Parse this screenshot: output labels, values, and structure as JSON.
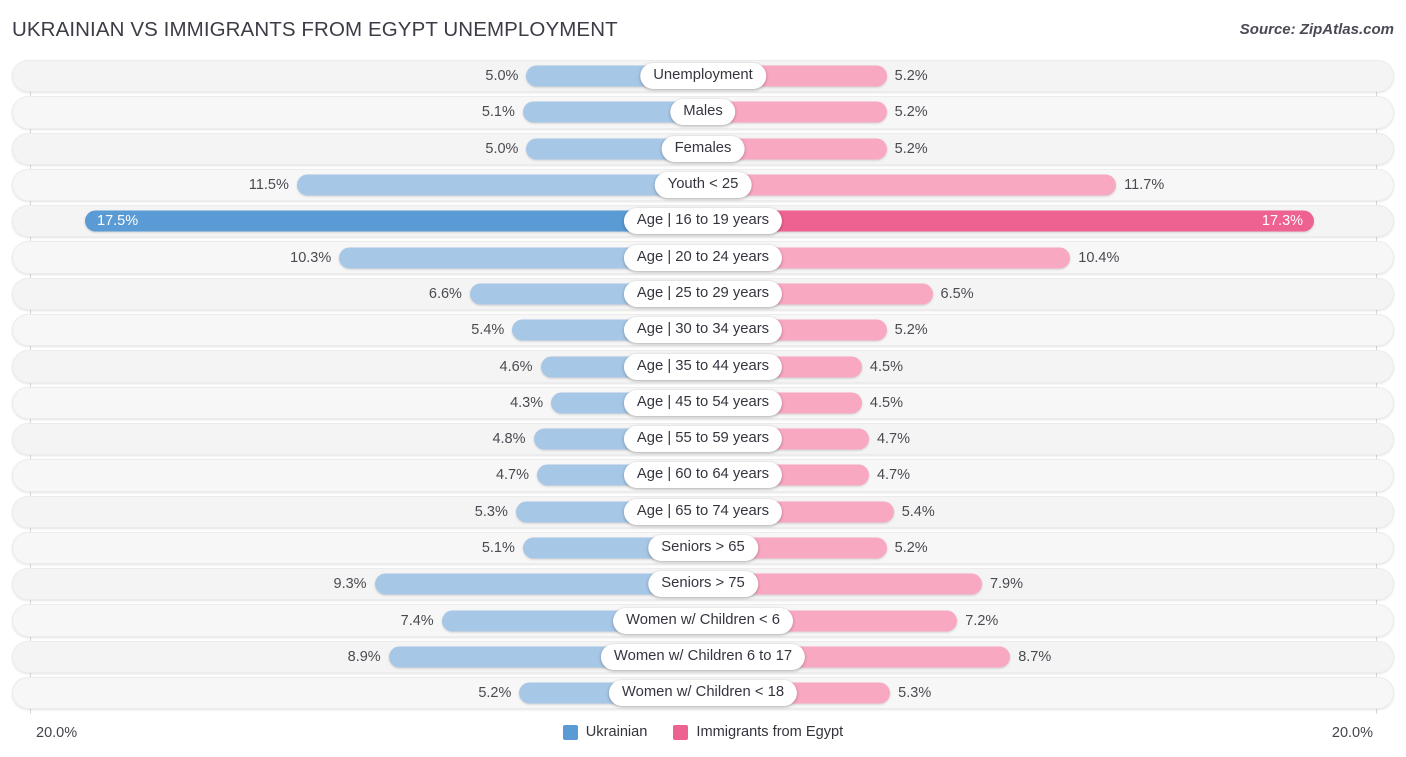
{
  "header": {
    "title": "UKRAINIAN VS IMMIGRANTS FROM EGYPT UNEMPLOYMENT",
    "source": "Source: ZipAtlas.com"
  },
  "axis": {
    "left_label": "20.0%",
    "right_label": "20.0%",
    "max": 20.0
  },
  "legend": {
    "items": [
      {
        "label": "Ukrainian",
        "color": "#5b9bd5"
      },
      {
        "label": "Immigrants from Egypt",
        "color": "#ee6292"
      }
    ]
  },
  "colors": {
    "left_normal": "#a7c7e7",
    "right_normal": "#f9a8c2",
    "left_highlight": "#5b9bd5",
    "right_highlight": "#ee6292",
    "track": "#f4f4f4",
    "track_alt": "#f7f7f7"
  },
  "chart_data": {
    "type": "bar",
    "subtype": "diverging-bidirectional",
    "title": "UKRAINIAN VS IMMIGRANTS FROM EGYPT UNEMPLOYMENT",
    "xlabel": "",
    "ylabel": "",
    "xlim": [
      20.0,
      20.0
    ],
    "grid": false,
    "legend_position": "bottom-center",
    "unit": "%",
    "categories": [
      "Unemployment",
      "Males",
      "Females",
      "Youth < 25",
      "Age | 16 to 19 years",
      "Age | 20 to 24 years",
      "Age | 25 to 29 years",
      "Age | 30 to 34 years",
      "Age | 35 to 44 years",
      "Age | 45 to 54 years",
      "Age | 55 to 59 years",
      "Age | 60 to 64 years",
      "Age | 65 to 74 years",
      "Seniors > 65",
      "Seniors > 75",
      "Women w/ Children < 6",
      "Women w/ Children 6 to 17",
      "Women w/ Children < 18"
    ],
    "series": [
      {
        "name": "Ukrainian",
        "side": "left",
        "color": "#a7c7e7",
        "values": [
          5.0,
          5.1,
          5.0,
          11.5,
          17.5,
          10.3,
          6.6,
          5.4,
          4.6,
          4.3,
          4.8,
          4.7,
          5.3,
          5.1,
          9.3,
          7.4,
          8.9,
          5.2
        ],
        "labels": [
          "5.0%",
          "5.1%",
          "5.0%",
          "11.5%",
          "17.5%",
          "10.3%",
          "6.6%",
          "5.4%",
          "4.6%",
          "4.3%",
          "4.8%",
          "4.7%",
          "5.3%",
          "5.1%",
          "9.3%",
          "7.4%",
          "8.9%",
          "5.2%"
        ]
      },
      {
        "name": "Immigrants from Egypt",
        "side": "right",
        "color": "#f9a8c2",
        "values": [
          5.2,
          5.2,
          5.2,
          11.7,
          17.3,
          10.4,
          6.5,
          5.2,
          4.5,
          4.5,
          4.7,
          4.7,
          5.4,
          5.2,
          7.9,
          7.2,
          8.7,
          5.3
        ],
        "labels": [
          "5.2%",
          "5.2%",
          "5.2%",
          "11.7%",
          "17.3%",
          "10.4%",
          "6.5%",
          "5.2%",
          "4.5%",
          "4.5%",
          "4.7%",
          "4.7%",
          "5.4%",
          "5.2%",
          "7.9%",
          "7.2%",
          "8.7%",
          "5.3%"
        ]
      }
    ],
    "highlighted_index": 4
  }
}
